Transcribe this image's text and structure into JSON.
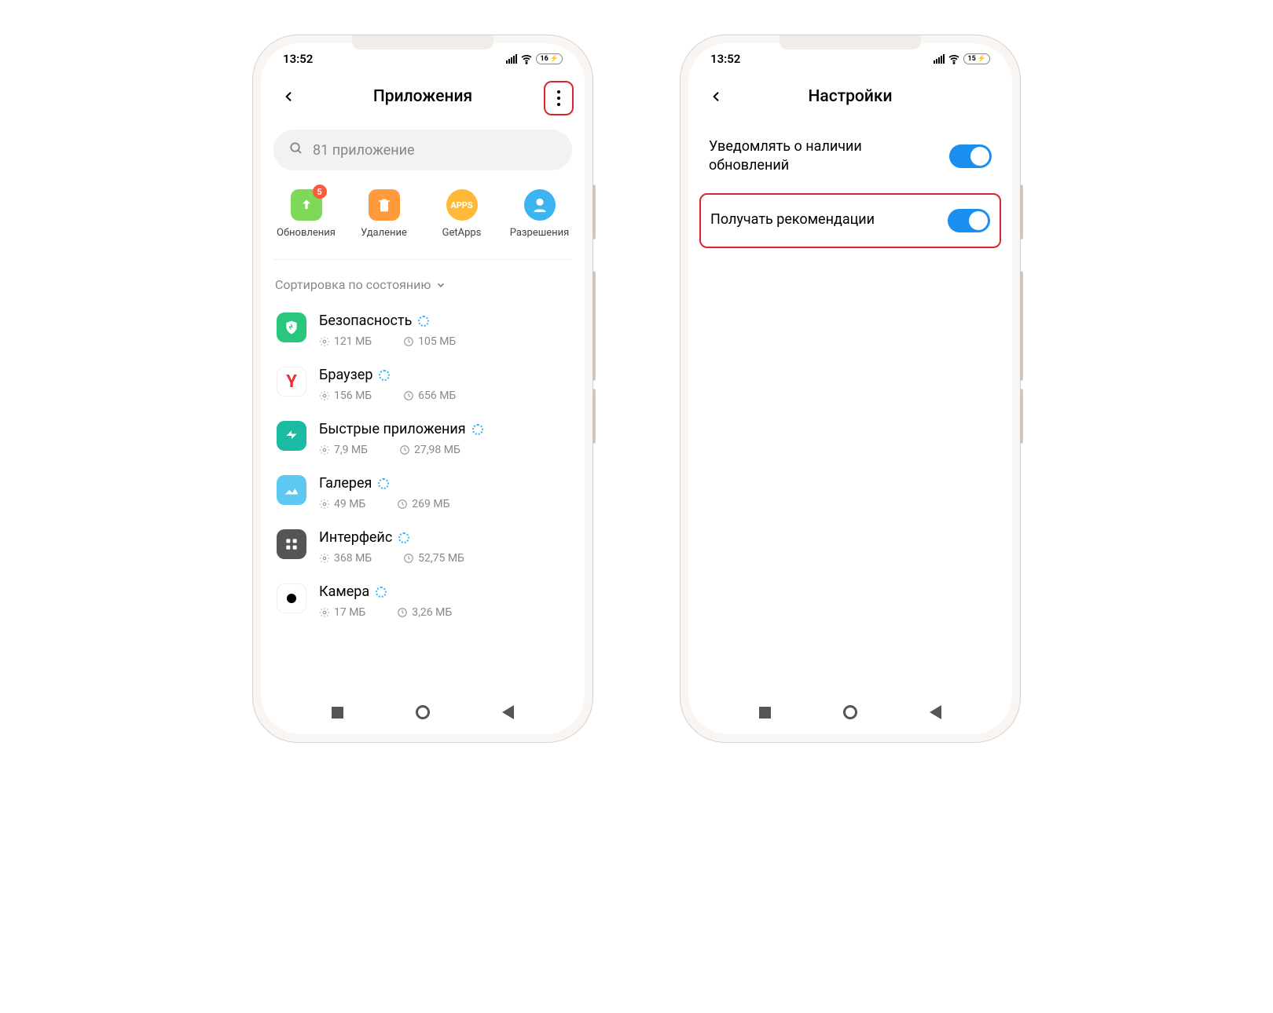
{
  "status": {
    "time": "13:52",
    "battery_left": "16",
    "battery_right": "15"
  },
  "screen1": {
    "title": "Приложения",
    "search_placeholder": "81 приложение",
    "quick": [
      {
        "label": "Обновления",
        "badge": "5"
      },
      {
        "label": "Удаление"
      },
      {
        "label": "GetApps"
      },
      {
        "label": "Разрешения"
      }
    ],
    "sort_label": "Сортировка по состоянию",
    "apps": [
      {
        "name": "Безопасность",
        "storage": "121 МБ",
        "time": "105 МБ",
        "icon": "shield"
      },
      {
        "name": "Браузер",
        "storage": "156 МБ",
        "time": "656 МБ",
        "icon": "y"
      },
      {
        "name": "Быстрые приложения",
        "storage": "7,9 МБ",
        "time": "27,98 МБ",
        "icon": "quick"
      },
      {
        "name": "Галерея",
        "storage": "49 МБ",
        "time": "269 МБ",
        "icon": "gallery"
      },
      {
        "name": "Интерфейс",
        "storage": "368 МБ",
        "time": "52,75 МБ",
        "icon": "iface"
      },
      {
        "name": "Камера",
        "storage": "17 МБ",
        "time": "3,26 МБ",
        "icon": "cam"
      }
    ]
  },
  "screen2": {
    "title": "Настройки",
    "settings": [
      {
        "label": "Уведомлять о наличии обновлений",
        "on": true,
        "highlighted": false
      },
      {
        "label": "Получать рекомендации",
        "on": true,
        "highlighted": true
      }
    ]
  }
}
